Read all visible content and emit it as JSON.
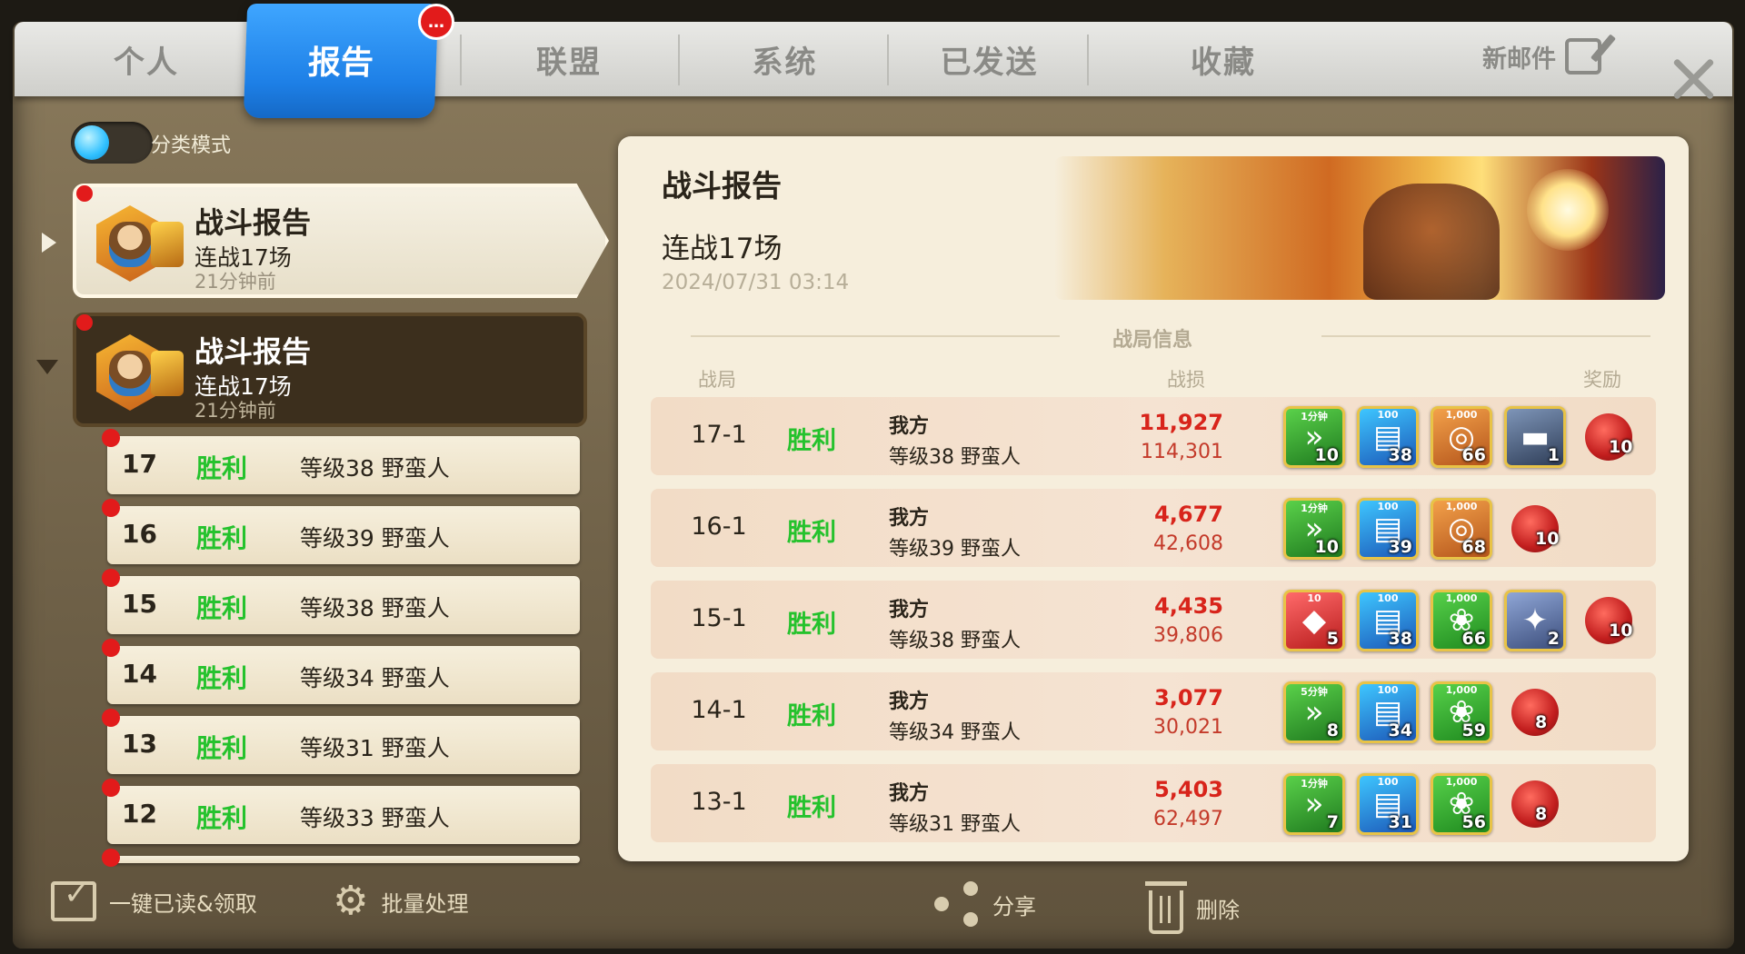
{
  "tabs": {
    "personal": "个人",
    "report": "报告",
    "report_badge": "…",
    "alliance": "联盟",
    "system": "系统",
    "sent": "已发送",
    "favorites": "收藏"
  },
  "header": {
    "new_mail": "新邮件"
  },
  "left": {
    "toggle_label": "分类模式",
    "toggle_on": true,
    "reports": [
      {
        "title": "战斗报告",
        "subtitle": "连战17场",
        "time": "21分钟前"
      },
      {
        "title": "战斗报告",
        "subtitle": "连战17场",
        "time": "21分钟前"
      }
    ],
    "battles": [
      {
        "num": "17",
        "result": "胜利",
        "opponent": "等级38 野蛮人"
      },
      {
        "num": "16",
        "result": "胜利",
        "opponent": "等级39 野蛮人"
      },
      {
        "num": "15",
        "result": "胜利",
        "opponent": "等级38 野蛮人"
      },
      {
        "num": "14",
        "result": "胜利",
        "opponent": "等级34 野蛮人"
      },
      {
        "num": "13",
        "result": "胜利",
        "opponent": "等级31 野蛮人"
      },
      {
        "num": "12",
        "result": "胜利",
        "opponent": "等级33 野蛮人"
      }
    ]
  },
  "detail": {
    "title": "战斗报告",
    "subtitle": "连战17场",
    "date": "2024/07/31 03:14",
    "section_title": "战局信息",
    "col_battle": "战局",
    "col_loss": "战损",
    "col_reward": "奖励",
    "rows": [
      {
        "id": "17-1",
        "result": "胜利",
        "self": "我方",
        "opponent": "等级38 野蛮人",
        "loss_a": "11,927",
        "loss_b": "114,301",
        "rewards": [
          {
            "type": "speed",
            "label": "1分钟",
            "count": "10"
          },
          {
            "type": "book",
            "label": "100",
            "count": "38"
          },
          {
            "type": "wood",
            "label": "1,000",
            "count": "66"
          },
          {
            "type": "iron",
            "label": "",
            "count": "1"
          }
        ],
        "seal": "10"
      },
      {
        "id": "16-1",
        "result": "胜利",
        "self": "我方",
        "opponent": "等级39 野蛮人",
        "loss_a": "4,677",
        "loss_b": "42,608",
        "rewards": [
          {
            "type": "speed",
            "label": "1分钟",
            "count": "10"
          },
          {
            "type": "book",
            "label": "100",
            "count": "39"
          },
          {
            "type": "wood",
            "label": "1,000",
            "count": "68"
          }
        ],
        "seal": "10"
      },
      {
        "id": "15-1",
        "result": "胜利",
        "self": "我方",
        "opponent": "等级38 野蛮人",
        "loss_a": "4,435",
        "loss_b": "39,806",
        "rewards": [
          {
            "type": "gem",
            "label": "10",
            "count": "5"
          },
          {
            "type": "book",
            "label": "100",
            "count": "38"
          },
          {
            "type": "food",
            "label": "1,000",
            "count": "66"
          },
          {
            "type": "stone",
            "label": "",
            "count": "2"
          }
        ],
        "seal": "10"
      },
      {
        "id": "14-1",
        "result": "胜利",
        "self": "我方",
        "opponent": "等级34 野蛮人",
        "loss_a": "3,077",
        "loss_b": "30,021",
        "rewards": [
          {
            "type": "speed",
            "label": "5分钟",
            "count": "8"
          },
          {
            "type": "book",
            "label": "100",
            "count": "34"
          },
          {
            "type": "food",
            "label": "1,000",
            "count": "59"
          }
        ],
        "seal": "8"
      },
      {
        "id": "13-1",
        "result": "胜利",
        "self": "我方",
        "opponent": "等级31 野蛮人",
        "loss_a": "5,403",
        "loss_b": "62,497",
        "rewards": [
          {
            "type": "speed",
            "label": "1分钟",
            "count": "7"
          },
          {
            "type": "book",
            "label": "100",
            "count": "31"
          },
          {
            "type": "food",
            "label": "1,000",
            "count": "56"
          }
        ],
        "seal": "8"
      }
    ]
  },
  "bottom": {
    "read_all": "一键已读&领取",
    "batch": "批量处理",
    "share": "分享",
    "delete": "删除"
  },
  "colors": {
    "tab_active": "#1d7fe6",
    "victory": "#25c22d",
    "loss": "#d8241b",
    "badge": "#e21b1b"
  }
}
